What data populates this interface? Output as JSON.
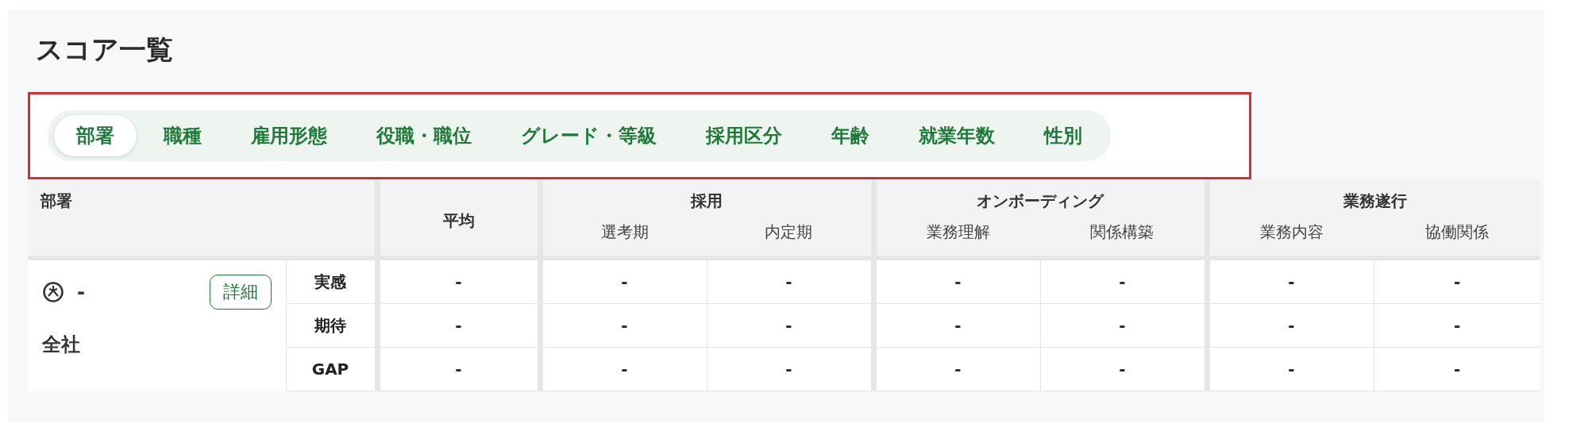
{
  "title": "スコア一覧",
  "tabs_highlighted": true,
  "tabs": [
    {
      "label": "部署",
      "selected": true
    },
    {
      "label": "職種",
      "selected": false
    },
    {
      "label": "雇用形態",
      "selected": false
    },
    {
      "label": "役職・職位",
      "selected": false
    },
    {
      "label": "グレード・等級",
      "selected": false
    },
    {
      "label": "採用区分",
      "selected": false
    },
    {
      "label": "年齢",
      "selected": false
    },
    {
      "label": "就業年数",
      "selected": false
    },
    {
      "label": "性別",
      "selected": false
    }
  ],
  "table": {
    "group_header": "部署",
    "average_header": "平均",
    "groups": [
      {
        "label": "採用",
        "columns": [
          "選考期",
          "内定期"
        ]
      },
      {
        "label": "オンボーディング",
        "columns": [
          "業務理解",
          "関係構築"
        ]
      },
      {
        "label": "業務遂行",
        "columns": [
          "業務内容",
          "協働関係"
        ]
      }
    ],
    "org": {
      "score": "-",
      "detail_button": "詳細",
      "name": "全社"
    },
    "rows": [
      {
        "label": "実感",
        "average": "-",
        "values": [
          "-",
          "-",
          "-",
          "-",
          "-",
          "-"
        ]
      },
      {
        "label": "期待",
        "average": "-",
        "values": [
          "-",
          "-",
          "-",
          "-",
          "-",
          "-"
        ]
      },
      {
        "label": "GAP",
        "average": "-",
        "values": [
          "-",
          "-",
          "-",
          "-",
          "-",
          "-"
        ]
      }
    ]
  }
}
